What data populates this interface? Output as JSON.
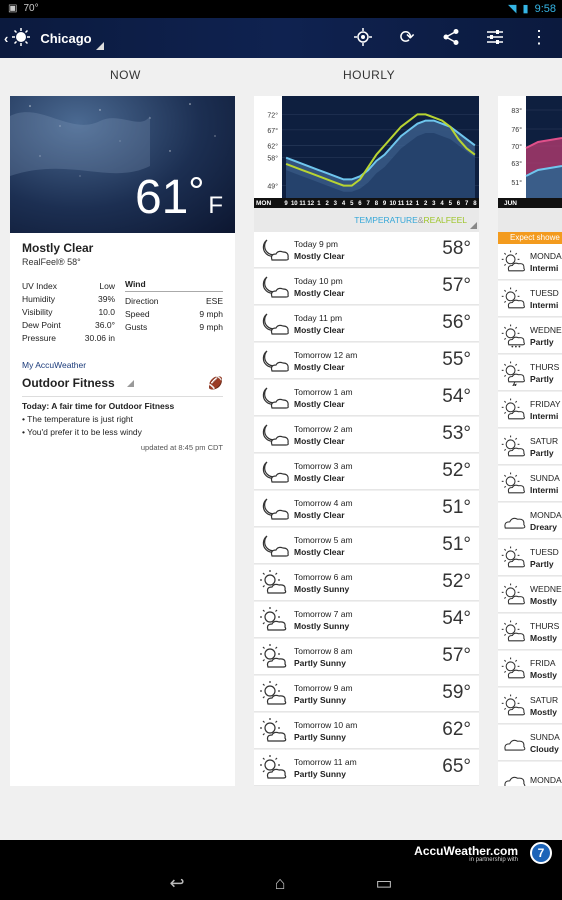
{
  "statusbar": {
    "temp": "70°",
    "time": "9:58"
  },
  "appbar": {
    "city": "Chicago",
    "actions": [
      "locate-icon",
      "refresh-icon",
      "share-icon",
      "settings-icon",
      "overflow-icon"
    ]
  },
  "columns": {
    "now": "NOW",
    "hourly": "HOURLY"
  },
  "now": {
    "temp": "61",
    "deg": "°",
    "unit": "F",
    "condition": "Mostly Clear",
    "realfeel": "RealFeel® 58°",
    "left": [
      {
        "label": "UV Index",
        "value": "Low"
      },
      {
        "label": "Humidity",
        "value": "39%"
      },
      {
        "label": "Visibility",
        "value": "10.0"
      },
      {
        "label": "Dew Point",
        "value": "36.0°"
      },
      {
        "label": "Pressure",
        "value": "30.06 in"
      }
    ],
    "wind_title": "Wind",
    "wind": [
      {
        "label": "Direction",
        "value": "ESE"
      },
      {
        "label": "Speed",
        "value": "9 mph"
      },
      {
        "label": "Gusts",
        "value": "9 mph"
      }
    ],
    "my_accu": "My AccuWeather",
    "fitness": "Outdoor Fitness",
    "fit_title": "Today: A fair time for Outdoor Fitness",
    "fit_b1": "• The temperature is just right",
    "fit_b2": "• You'd prefer it to be less windy",
    "updated": "updated at 8:45 pm CDT"
  },
  "hourly_chart": {
    "y_ticks": [
      "72°",
      "67°",
      "62°",
      "58°",
      "49°"
    ],
    "x_label": "MON",
    "x_ticks": [
      "9",
      "10",
      "11",
      "12",
      "1",
      "2",
      "3",
      "4",
      "5",
      "6",
      "7",
      "8",
      "9",
      "10",
      "11",
      "12",
      "1",
      "2",
      "3",
      "4",
      "5",
      "6",
      "7",
      "8"
    ],
    "legend_temp": "TEMPERATURE",
    "legend_amp": " & ",
    "legend_rf": "REALFEEL"
  },
  "chart_data": {
    "type": "area",
    "xlabel": "MON",
    "x": [
      "9",
      "10",
      "11",
      "12",
      "1",
      "2",
      "3",
      "4",
      "5",
      "6",
      "7",
      "8",
      "9",
      "10",
      "11",
      "12",
      "1",
      "2",
      "3",
      "4",
      "5",
      "6",
      "7",
      "8"
    ],
    "ylim": [
      45,
      76
    ],
    "series": [
      {
        "name": "TEMPERATURE",
        "color": "#6fc6ee",
        "values": [
          58,
          57,
          56,
          55,
          54,
          53,
          52,
          51,
          51,
          52,
          54,
          57,
          59,
          62,
          65,
          67,
          69,
          70,
          70,
          69,
          68,
          66,
          64,
          62
        ]
      },
      {
        "name": "REALFEEL",
        "color": "#b8d432",
        "values": [
          56,
          55,
          54,
          53,
          52,
          51,
          50,
          49,
          49,
          51,
          55,
          59,
          62,
          65,
          68,
          70,
          72,
          72,
          71,
          70,
          68,
          64,
          61,
          59
        ]
      }
    ]
  },
  "hourly": [
    {
      "hour": "Today 9 pm",
      "desc": "Mostly Clear",
      "temp": "58°",
      "icon": "moon-cloud"
    },
    {
      "hour": "Today 10 pm",
      "desc": "Mostly Clear",
      "temp": "57°",
      "icon": "moon-cloud"
    },
    {
      "hour": "Today 11 pm",
      "desc": "Mostly Clear",
      "temp": "56°",
      "icon": "moon-cloud"
    },
    {
      "hour": "Tomorrow 12 am",
      "desc": "Mostly Clear",
      "temp": "55°",
      "icon": "moon-cloud"
    },
    {
      "hour": "Tomorrow 1 am",
      "desc": "Mostly Clear",
      "temp": "54°",
      "icon": "moon-cloud"
    },
    {
      "hour": "Tomorrow 2 am",
      "desc": "Mostly Clear",
      "temp": "53°",
      "icon": "moon-cloud"
    },
    {
      "hour": "Tomorrow 3 am",
      "desc": "Mostly Clear",
      "temp": "52°",
      "icon": "moon-cloud"
    },
    {
      "hour": "Tomorrow 4 am",
      "desc": "Mostly Clear",
      "temp": "51°",
      "icon": "moon-cloud"
    },
    {
      "hour": "Tomorrow 5 am",
      "desc": "Mostly Clear",
      "temp": "51°",
      "icon": "moon-cloud"
    },
    {
      "hour": "Tomorrow 6 am",
      "desc": "Mostly Sunny",
      "temp": "52°",
      "icon": "sun-cloud"
    },
    {
      "hour": "Tomorrow 7 am",
      "desc": "Mostly Sunny",
      "temp": "54°",
      "icon": "sun-cloud"
    },
    {
      "hour": "Tomorrow 8 am",
      "desc": "Partly Sunny",
      "temp": "57°",
      "icon": "sun-cloud"
    },
    {
      "hour": "Tomorrow 9 am",
      "desc": "Partly Sunny",
      "temp": "59°",
      "icon": "sun-cloud"
    },
    {
      "hour": "Tomorrow 10 am",
      "desc": "Partly Sunny",
      "temp": "62°",
      "icon": "sun-cloud"
    },
    {
      "hour": "Tomorrow 11 am",
      "desc": "Partly Sunny",
      "temp": "65°",
      "icon": "sun-cloud"
    }
  ],
  "daily_chart": {
    "y_ticks": [
      "83°",
      "76°",
      "70°",
      "63°",
      "51°"
    ],
    "x_label": "JUN"
  },
  "daily": {
    "banner": "Expect showe",
    "rows": [
      {
        "day": "MONDA",
        "desc": "Intermi",
        "icon": "sun-cloud"
      },
      {
        "day": "TUESD",
        "desc": "Intermi",
        "icon": "sun-cloud"
      },
      {
        "day": "WEDNE",
        "desc": "Partly",
        "icon": "sun-rain"
      },
      {
        "day": "THURS",
        "desc": "Partly",
        "icon": "sun-storm"
      },
      {
        "day": "FRIDAY",
        "desc": "Intermi",
        "icon": "sun-cloud"
      },
      {
        "day": "SATUR",
        "desc": "Partly",
        "icon": "sun-cloud"
      },
      {
        "day": "SUNDA",
        "desc": "Intermi",
        "icon": "sun-cloud"
      },
      {
        "day": "MONDA",
        "desc": "Dreary",
        "icon": "cloud"
      },
      {
        "day": "TUESD",
        "desc": "Partly",
        "icon": "sun-cloud"
      },
      {
        "day": "WEDNE",
        "desc": "Mostly",
        "icon": "sun-cloud"
      },
      {
        "day": "THURS",
        "desc": "Mostly",
        "icon": "sun-cloud"
      },
      {
        "day": "FRIDA",
        "desc": "Mostly",
        "icon": "sun-cloud"
      },
      {
        "day": "SATUR",
        "desc": "Mostly",
        "icon": "sun-cloud"
      },
      {
        "day": "SUNDA",
        "desc": "Cloudy",
        "icon": "cloud"
      },
      {
        "day": "MONDA",
        "desc": "",
        "icon": "cloud"
      }
    ]
  },
  "ad": {
    "logo": "AccuWeather.com",
    "sub": "in partnership with",
    "abc": "7"
  }
}
